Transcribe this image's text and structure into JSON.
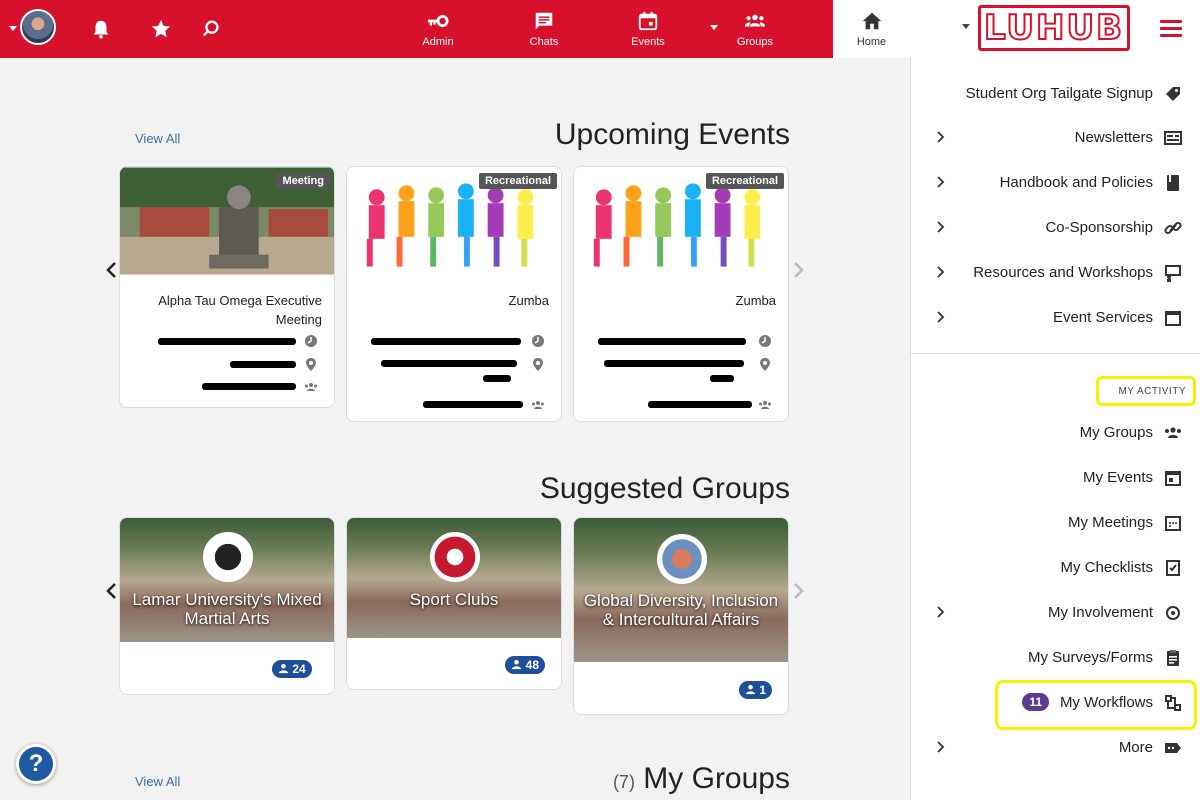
{
  "header": {
    "logo_text": "LUHUB",
    "nav": [
      {
        "label": "Home",
        "icon": "home-icon"
      },
      {
        "label": "Groups",
        "icon": "groups-icon"
      },
      {
        "label": "Events",
        "icon": "calendar-icon"
      },
      {
        "label": "Chats",
        "icon": "chat-icon"
      },
      {
        "label": "Admin",
        "icon": "key-icon"
      }
    ],
    "accent_color": "#d7112b"
  },
  "sidebar": {
    "items": [
      {
        "label": "Student Org Tailgate Signup",
        "icon": "tag-icon"
      },
      {
        "label": "Newsletters",
        "icon": "newspaper-icon"
      },
      {
        "label": "Handbook and Policies",
        "icon": "book-icon"
      },
      {
        "label": "Co-Sponsorship",
        "icon": "link-icon"
      },
      {
        "label": "Resources and Workshops",
        "icon": "presenter-icon"
      },
      {
        "label": "Event Services",
        "icon": "calendar-outline-icon"
      }
    ],
    "activity_heading": "MY ACTIVITY",
    "activity_items": [
      {
        "label": "My Groups",
        "icon": "groups-icon"
      },
      {
        "label": "My Events",
        "icon": "calendar-icon"
      },
      {
        "label": "My Meetings",
        "icon": "meeting-icon"
      },
      {
        "label": "My Checklists",
        "icon": "checklist-icon"
      },
      {
        "label": "My Involvement",
        "icon": "involvement-icon"
      },
      {
        "label": "My Surveys/Forms",
        "icon": "clipboard-icon"
      },
      {
        "label": "My Workflows",
        "icon": "workflow-icon",
        "badge": "11"
      },
      {
        "label": "More",
        "icon": "label-icon"
      }
    ]
  },
  "upcoming_events": {
    "title": "Upcoming Events",
    "view_all": "View All",
    "events": [
      {
        "title": "Zumba",
        "category": "Recreational"
      },
      {
        "title": "Zumba",
        "category": "Recreational"
      },
      {
        "title": "Alpha Tau Omega Executive Meeting",
        "category": "Meeting"
      }
    ]
  },
  "suggested_groups": {
    "title": "Suggested Groups",
    "groups": [
      {
        "name": "Global Diversity, Inclusion & Intercultural Affairs",
        "members": "1"
      },
      {
        "name": "Sport Clubs",
        "members": "48"
      },
      {
        "name": "Lamar University's Mixed Martial Arts",
        "members": "24"
      }
    ]
  },
  "my_groups": {
    "title": "My Groups",
    "count": "(7)",
    "view_all": "View All"
  },
  "help_label": "?"
}
